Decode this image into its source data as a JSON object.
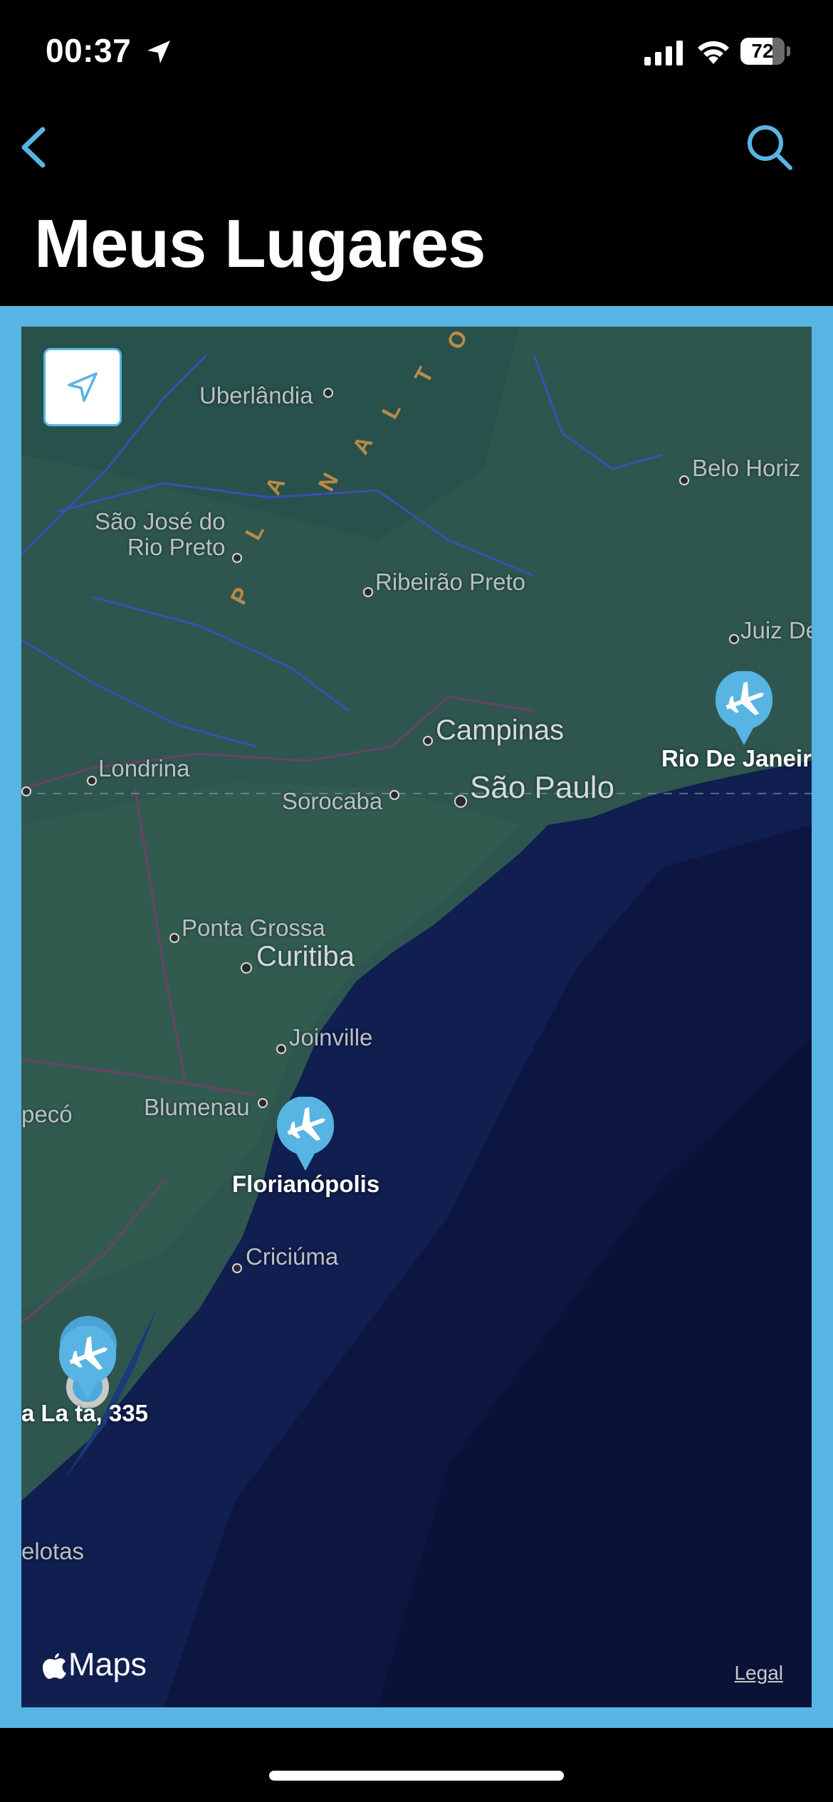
{
  "status_bar": {
    "time": "00:37",
    "battery": "72",
    "battery_level": 0.72
  },
  "nav": {
    "back_icon": "chevron-left-icon",
    "search_icon": "search-icon",
    "accent_color": "#58b4e2"
  },
  "page": {
    "title": "Meus Lugares"
  },
  "map": {
    "cities": {
      "uberlandia": "Uberlândia",
      "belo_horizonte": "Belo Horiz",
      "sao_jose": "São José do\nRio Preto",
      "ribeirao": "Ribeirão Preto",
      "juiz": "Juiz De",
      "campinas": "Campinas",
      "londrina": "Londrina",
      "sorocaba": "Sorocaba",
      "sao_paulo": "São Paulo",
      "ponta_grossa": "Ponta Grossa",
      "curitiba": "Curitiba",
      "joinville": "Joinville",
      "chapeco": "pecó",
      "blumenau": "Blumenau",
      "criciuma": "Criciúma",
      "pelotas": "elotas"
    },
    "region_letters": [
      "P",
      "L",
      "A",
      "N",
      "A",
      "L",
      "T",
      "O"
    ],
    "pins": [
      {
        "label": "Rio De Janeir",
        "icon": "airplane-icon"
      },
      {
        "label": "Florianópolis",
        "icon": "airplane-icon"
      },
      {
        "label": "a La    ta, 335",
        "icon": "airplane-icon"
      }
    ],
    "maps_brand": "Maps",
    "legal": "Legal"
  }
}
